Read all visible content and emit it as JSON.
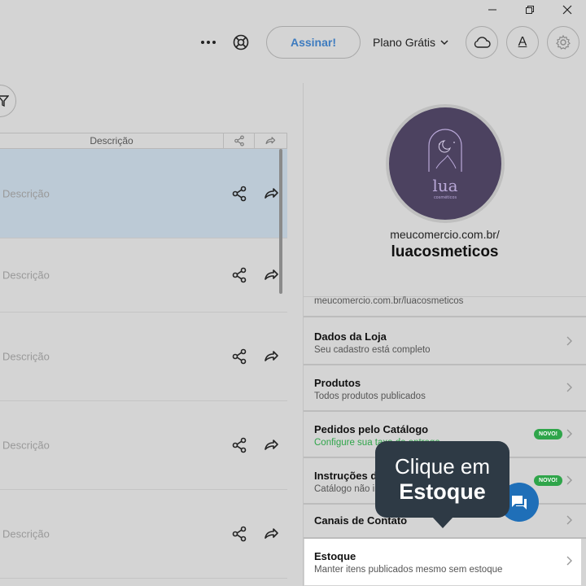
{
  "window": {
    "minimize_icon": "minimize-icon",
    "restore_icon": "restore-icon",
    "close_icon": "close-icon"
  },
  "toolbar": {
    "more_icon": "more-dots-icon",
    "help_icon": "lifebuoy-icon",
    "subscribe_label": "Assinar!",
    "plan_label": "Plano Grátis",
    "cloud_icon": "cloud-icon",
    "font_icon_label": "A",
    "settings_icon": "gear-icon"
  },
  "table": {
    "header": {
      "description": "Descrição"
    },
    "rows": [
      {
        "description": "Descrição",
        "selected": true
      },
      {
        "description": "Descrição",
        "selected": false
      },
      {
        "description": "Descrição",
        "selected": false
      },
      {
        "description": "Descrição",
        "selected": false
      },
      {
        "description": "Descrição",
        "selected": false
      }
    ]
  },
  "store": {
    "logo_text": "lua",
    "logo_subtext": "cosméticos",
    "url_prefix": "meucomercio.com.br/",
    "name": "luacosmeticos",
    "full_url": "meucomercio.com.br/luacosmeticos"
  },
  "menu": [
    {
      "title": "Dados da Loja",
      "subtitle": "Seu cadastro está completo",
      "badge": ""
    },
    {
      "title": "Produtos",
      "subtitle": "Todos produtos publicados",
      "badge": ""
    },
    {
      "title": "Pedidos pelo Catálogo",
      "subtitle": "Configure sua taxa de entrega",
      "badge": "NOVO!"
    },
    {
      "title": "Instruções de Compra",
      "subtitle": "Catálogo não informado",
      "badge": "NOVO!"
    },
    {
      "title": "Canais de Contato",
      "subtitle": "",
      "badge": ""
    },
    {
      "title": "Estoque",
      "subtitle": "Manter itens publicados mesmo sem estoque",
      "badge": ""
    }
  ],
  "tooltip": {
    "line1": "Clique em",
    "line2": "Estoque"
  },
  "colors": {
    "accent": "#3d7bbf",
    "green": "#2fa54a",
    "tooltip_bg": "#2e3a45",
    "fab": "#1f6fb8",
    "selected_row": "#bccad6"
  }
}
